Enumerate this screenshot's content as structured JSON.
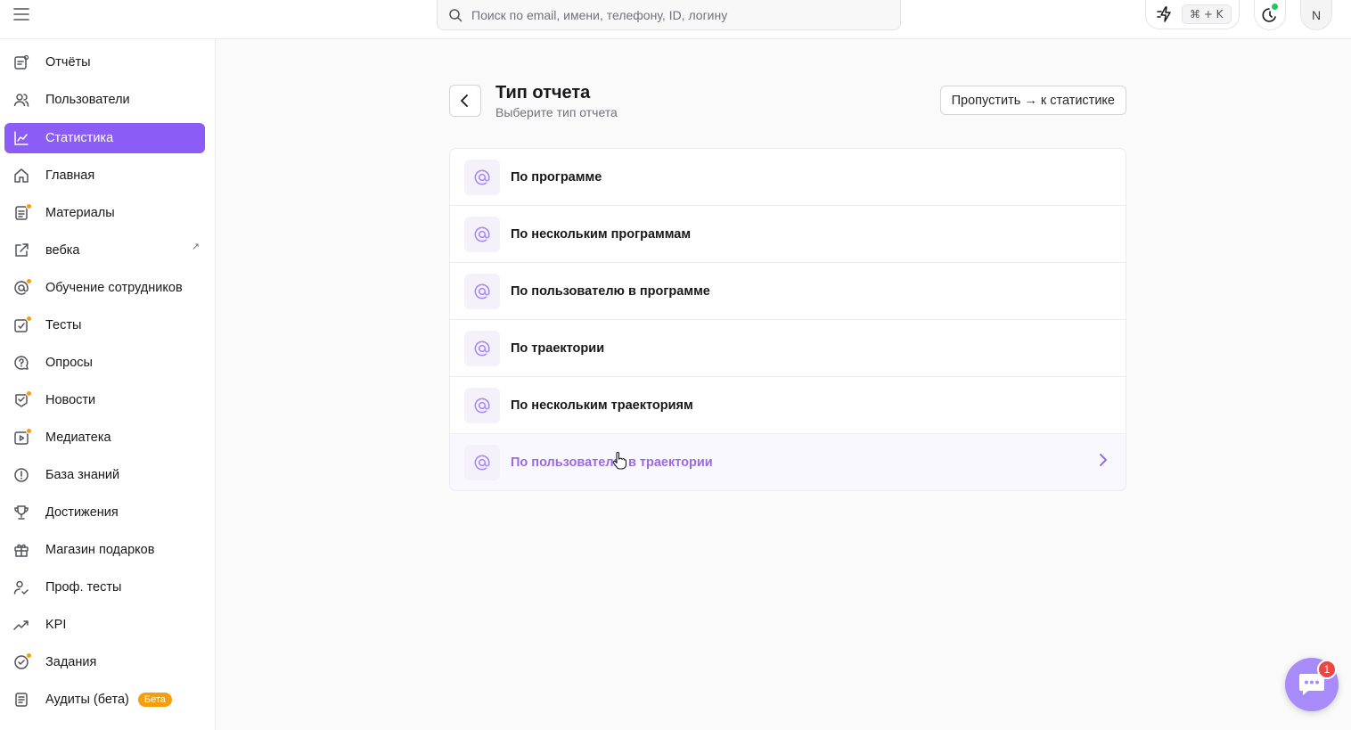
{
  "topbar": {
    "search_placeholder": "Поиск по email, имени, телефону, ID, логину",
    "shortcut": "⌘ + K",
    "avatar_initial": "N",
    "status_color": "#22c55e"
  },
  "sidebar": {
    "accent": "#8b5cf6",
    "items": [
      {
        "label": "Отчёты",
        "icon": "report-icon"
      },
      {
        "label": "Пользователи",
        "icon": "users-icon"
      },
      {
        "label": "Статистика",
        "icon": "chart-line-icon",
        "active": true
      },
      {
        "label": "Главная",
        "icon": "home-icon"
      },
      {
        "label": "Материалы",
        "icon": "document-icon",
        "dot": true
      },
      {
        "label": "вебка",
        "icon": "external-link-icon",
        "external": "↗"
      },
      {
        "label": "Обучение сотрудников",
        "icon": "at-icon",
        "dot": true
      },
      {
        "label": "Тесты",
        "icon": "test-icon",
        "dot": true
      },
      {
        "label": "Опросы",
        "icon": "question-icon"
      },
      {
        "label": "Новости",
        "icon": "news-icon",
        "dot": true
      },
      {
        "label": "Медиатека",
        "icon": "media-icon",
        "dot": true
      },
      {
        "label": "База знаний",
        "icon": "info-icon"
      },
      {
        "label": "Достижения",
        "icon": "trophy-icon"
      },
      {
        "label": "Магазин подарков",
        "icon": "gift-icon"
      },
      {
        "label": "Проф. тесты",
        "icon": "user-check-icon"
      },
      {
        "label": "KPI",
        "icon": "trend-icon"
      },
      {
        "label": "Задания",
        "icon": "task-icon",
        "dot": true
      },
      {
        "label": "Аудиты (бета)",
        "icon": "audit-icon",
        "badge": "Бета"
      }
    ]
  },
  "main": {
    "title": "Тип отчета",
    "subtitle": "Выберите тип отчета",
    "skip_label": "Пропустить → к статистике",
    "report_types": [
      {
        "label": "По программе"
      },
      {
        "label": "По нескольким программам"
      },
      {
        "label": "По пользователю в программе"
      },
      {
        "label": "По траектории"
      },
      {
        "label": "По нескольким траекториям"
      },
      {
        "label": "По пользователю в траектории",
        "hover": true
      }
    ]
  },
  "chat": {
    "unread": "1"
  }
}
